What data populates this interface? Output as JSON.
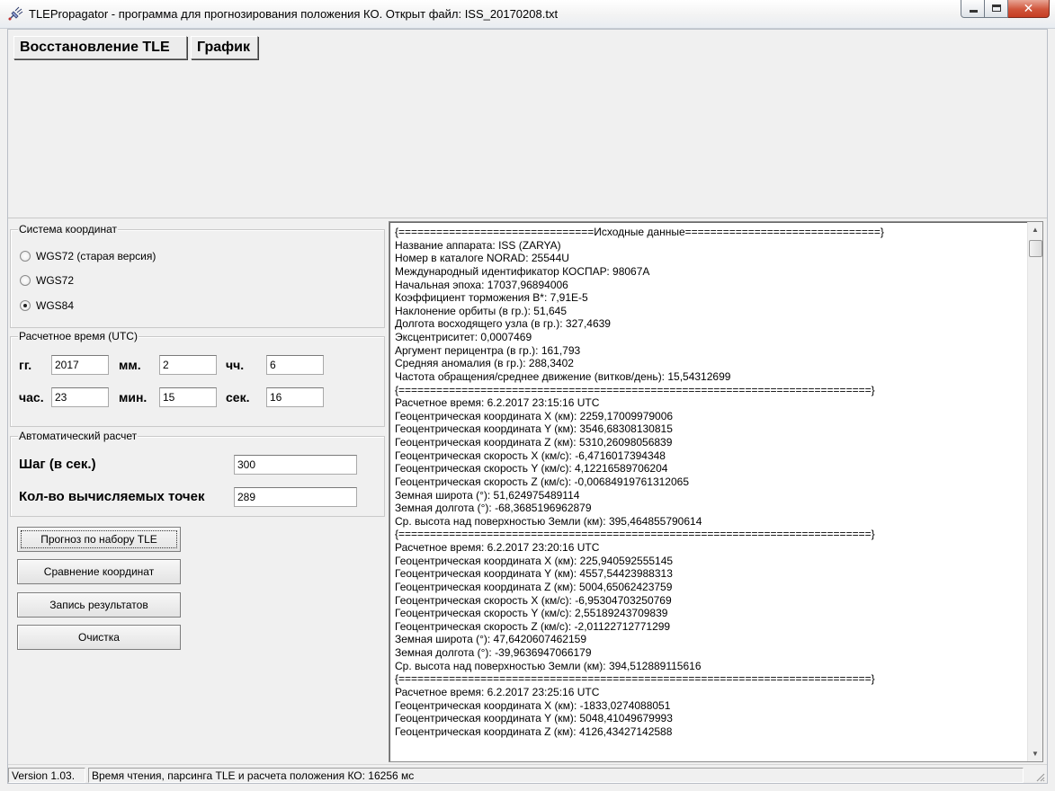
{
  "window": {
    "title": "TLEPropagator - программа для прогнозирования положения КО. Открыт файл: ISS_20170208.txt"
  },
  "toolbar": {
    "restore_label": "Восстановление TLE",
    "chart_label": "График"
  },
  "coordinate_system": {
    "caption": "Система координат",
    "options": [
      {
        "label": "WGS72 (старая версия)",
        "checked": false
      },
      {
        "label": "WGS72",
        "checked": false
      },
      {
        "label": "WGS84",
        "checked": true
      }
    ]
  },
  "calc_time": {
    "caption": "Расчетное время (UTC)",
    "year_label": "гг.",
    "year_value": "2017",
    "month_label": "мм.",
    "month_value": "2",
    "day_label": "чч.",
    "day_value": "6",
    "hour_label": "час.",
    "hour_value": "23",
    "minute_label": "мин.",
    "minute_value": "15",
    "second_label": "сек.",
    "second_value": "16"
  },
  "auto_calc": {
    "caption": "Автоматический расчет",
    "step_label": "Шаг (в сек.)",
    "step_value": "300",
    "points_label": "Кол-во вычисляемых точек",
    "points_value": "289"
  },
  "actions": {
    "forecast_label": "Прогноз по набору TLE",
    "compare_label": "Сравнение координат",
    "save_label": "Запись результатов",
    "clear_label": "Очистка"
  },
  "output": {
    "lines": [
      "{===============================Исходные данные===============================}",
      "Название аппарата: ISS (ZARYA)",
      "Номер в каталоге NORAD: 25544U",
      "Международный идентификатор КОСПАР: 98067A",
      "Начальная эпоха: 17037,96894006",
      "Коэффициент торможения B*: 7,91E-5",
      "Наклонение орбиты (в гр.): 51,645",
      "Долгота восходящего узла (в гр.): 327,4639",
      "Эксцентриситет: 0,0007469",
      "Аргумент перицентра (в гр.): 161,793",
      "Средняя аномалия (в гр.): 288,3402",
      "Частота обращения/среднее движение (витков/день): 15,54312699",
      "{===========================================================================}",
      "Расчетное время: 6.2.2017 23:15:16 UTC",
      "Геоцентрическая координата X (км): 2259,17009979006",
      "Геоцентрическая координата Y (км): 3546,68308130815",
      "Геоцентрическая координата Z (км): 5310,26098056839",
      "Геоцентрическая скорость X (км/с): -6,4716017394348",
      "Геоцентрическая скорость Y (км/с): 4,12216589706204",
      "Геоцентрическая скорость Z (км/с): -0,00684919761312065",
      "Земная широта (°): 51,624975489114",
      "Земная долгота (°): -68,3685196962879",
      "Ср. высота над поверхностью Земли (км): 395,464855790614",
      "{===========================================================================}",
      "Расчетное время: 6.2.2017 23:20:16 UTC",
      "Геоцентрическая координата X (км): 225,940592555145",
      "Геоцентрическая координата Y (км): 4557,54423988313",
      "Геоцентрическая координата Z (км): 5004,65062423759",
      "Геоцентрическая скорость X (км/с): -6,95304703250769",
      "Геоцентрическая скорость Y (км/с): 2,55189243709839",
      "Геоцентрическая скорость Z (км/с): -2,01122712771299",
      "Земная широта (°): 47,6420607462159",
      "Земная долгота (°): -39,9636947066179",
      "Ср. высота над поверхностью Земли (км): 394,512889115616",
      "{===========================================================================}",
      "Расчетное время: 6.2.2017 23:25:16 UTC",
      "Геоцентрическая координата X (км): -1833,0274088051",
      "Геоцентрическая координата Y (км): 5048,41049679993",
      "Геоцентрическая координата Z (км): 4126,43427142588"
    ]
  },
  "statusbar": {
    "version": "Version 1.03.",
    "message": "Время чтения, парсинга TLE и расчета положения КО: 16256 мс"
  },
  "icons": {
    "app": "satellite-icon",
    "minimize": "minimize-icon",
    "maximize": "maximize-icon",
    "close": "close-icon"
  },
  "colors": {
    "close_button": "#c63d23",
    "window_bg": "#f0f0f0"
  }
}
